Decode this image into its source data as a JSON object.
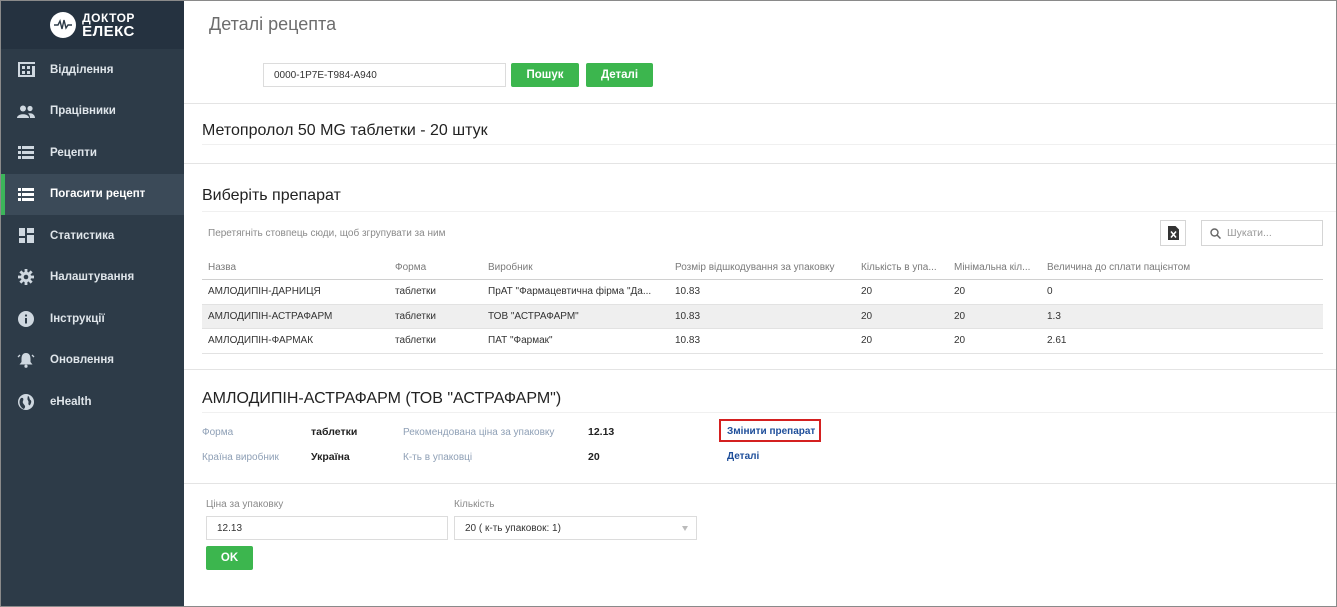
{
  "sidebar": {
    "logo": {
      "line1": "ДОКТОР",
      "line2": "ЕЛЕКС"
    },
    "items": [
      {
        "label": "Відділення",
        "icon": "building-icon"
      },
      {
        "label": "Працівники",
        "icon": "people-icon"
      },
      {
        "label": "Рецепти",
        "icon": "list-icon"
      },
      {
        "label": "Погасити рецепт",
        "icon": "list-icon",
        "active": true
      },
      {
        "label": "Статистика",
        "icon": "dashboard-icon"
      },
      {
        "label": "Налаштування",
        "icon": "gear-icon"
      },
      {
        "label": "Інструкції",
        "icon": "info-icon"
      },
      {
        "label": "Оновлення",
        "icon": "bell-icon"
      },
      {
        "label": "eHealth",
        "icon": "globe-icon"
      }
    ]
  },
  "header": {
    "title": "Деталі рецепта",
    "search_value": "0000-1P7E-T984-A940",
    "search_button": "Пошук",
    "details_button": "Деталі"
  },
  "prescription": {
    "title": "Метопролол 50 MG таблетки - 20 штук"
  },
  "select_drug": {
    "title": "Виберіть препарат",
    "group_hint": "Перетягніть стовпець сюди, щоб згрупувати за ним",
    "search_placeholder": "Шукати...",
    "columns": [
      "Назва",
      "Форма",
      "Виробник",
      "Розмір відшкодування за упаковку",
      "Кількість в упа...",
      "Мінімальна кіл...",
      "Величина до сплати пацієнтом"
    ],
    "rows": [
      [
        "АМЛОДИПІН-ДАРНИЦЯ",
        "таблетки",
        "ПрАТ \"Фармацевтична фірма \"Да...",
        "10.83",
        "20",
        "20",
        "0"
      ],
      [
        "АМЛОДИПІН-АСТРАФАРМ",
        "таблетки",
        "ТОВ \"АСТРАФАРМ\"",
        "10.83",
        "20",
        "20",
        "1.3"
      ],
      [
        "АМЛОДИПІН-ФАРМАК",
        "таблетки",
        "ПАТ \"Фармак\"",
        "10.83",
        "20",
        "20",
        "2.61"
      ]
    ],
    "selected_row": 1
  },
  "drug_details": {
    "title": "АМЛОДИПІН-АСТРАФАРМ (ТОВ \"АСТРАФАРМ\")",
    "form_label": "Форма",
    "form_value": "таблетки",
    "country_label": "Країна виробник",
    "country_value": "Україна",
    "price_label": "Рекомендована ціна за упаковку",
    "price_value": "12.13",
    "qty_label": "К-ть в упаковці",
    "qty_value": "20",
    "change_link": "Змінити препарат",
    "details_link": "Деталі"
  },
  "order": {
    "price_label": "Ціна за упаковку",
    "price_value": "12.13",
    "qty_label": "Кількість",
    "qty_value": "20 ( к-ть упаковок: 1)",
    "ok_button": "OK"
  },
  "colors": {
    "sidebar": "#2d3b48",
    "accent": "#3cb64e",
    "link": "#1e4e9a",
    "highlight": "#d42020"
  }
}
